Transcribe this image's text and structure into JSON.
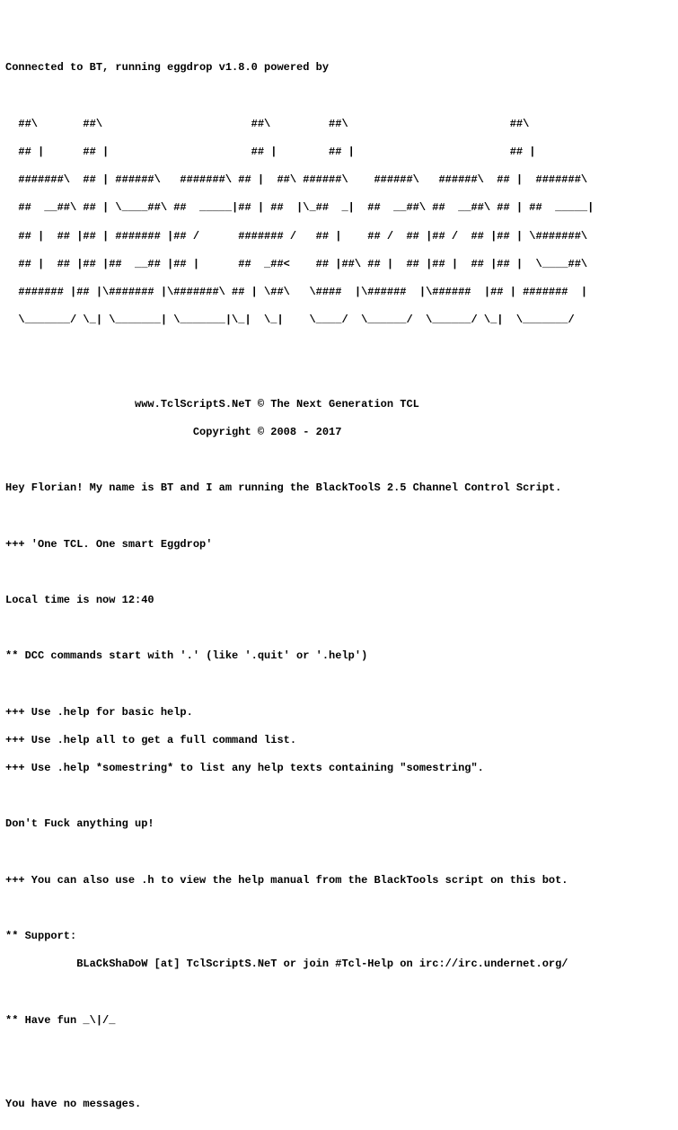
{
  "terminal": {
    "header": "Connected to BT, running eggdrop v1.8.0 powered by",
    "blank0": " ",
    "ascii1": "  ##\\       ##\\                       ##\\         ##\\                         ##\\",
    "ascii2": "  ## |      ## |                      ## |        ## |                        ## |",
    "ascii3": "  #######\\  ## | ######\\   #######\\ ## |  ##\\ ######\\    ######\\   ######\\  ## |  #######\\",
    "ascii4": "  ##  __##\\ ## | \\____##\\ ##  _____|## | ##  |\\_##  _|  ##  __##\\ ##  __##\\ ## | ##  _____|",
    "ascii5": "  ## |  ## |## | ####### |## /      ####### /   ## |    ## /  ## |## /  ## |## | \\#######\\",
    "ascii6": "  ## |  ## |## |##  __## |## |      ##  _##<    ## |##\\ ## |  ## |## |  ## |## |  \\____##\\",
    "ascii7": "  ####### |## |\\####### |\\#######\\ ## | \\##\\   \\####  |\\######  |\\######  |## | #######  |",
    "ascii8": "  \\_______/ \\_| \\_______| \\_______|\\_|  \\_|    \\____/  \\______/  \\______/ \\_|  \\_______/",
    "blank1": " ",
    "blank2": " ",
    "site": "                    www.TclScriptS.NeT © The Next Generation TCL",
    "copy": "                             Copyright © 2008 - 2017",
    "blank3": " ",
    "greet": "Hey Florian! My name is BT and I am running the BlackToolS 2.5 Channel Control Script.",
    "blank4": " ",
    "tag": "+++ 'One TCL. One smart Eggdrop'",
    "blank5": " ",
    "time": "Local time is now 12:40",
    "blank6": " ",
    "dcc": "** DCC commands start with '.' (like '.quit' or '.help')",
    "blank7": " ",
    "help1": "+++ Use .help for basic help.",
    "help2": "+++ Use .help all to get a full command list.",
    "help3": "+++ Use .help *somestring* to list any help texts containing \"somestring\".",
    "blank8": " ",
    "warn": "Don't Fuck anything up!",
    "blank9": " ",
    "hline": "+++ You can also use .h to view the help manual from the BlackTools script on this bot.",
    "blank10": " ",
    "sup1": "** Support:",
    "sup2": "           BLaCkShaDoW [at] TclScriptS.NeT or join #Tcl-Help on irc://irc.undernet.org/",
    "blank11": " ",
    "fun": "** Have fun _\\|/_",
    "blank12": " ",
    "blank13": " ",
    "msgs": "You have no messages."
  }
}
